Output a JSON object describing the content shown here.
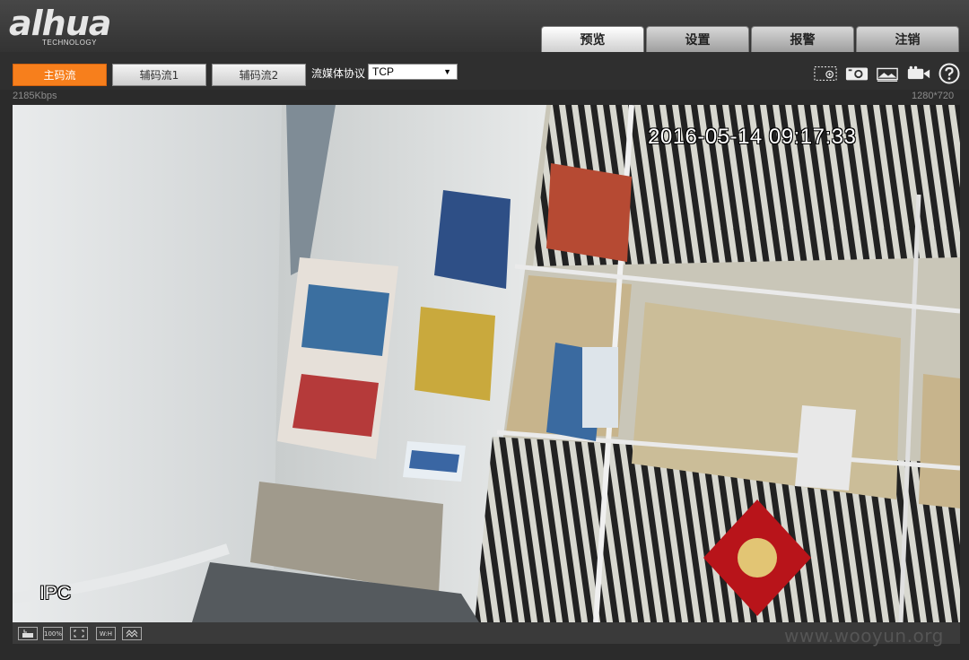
{
  "brand": {
    "name": "alhua",
    "tagline": "TECHNOLOGY"
  },
  "nav": {
    "tabs": [
      {
        "label": "预览",
        "active": true
      },
      {
        "label": "设置"
      },
      {
        "label": "报警"
      },
      {
        "label": "注销"
      }
    ]
  },
  "toolbar": {
    "stream_main": "主码流",
    "stream_sub1": "辅码流1",
    "stream_sub2": "辅码流2",
    "protocol_label": "流媒体协议",
    "protocol_value": "TCP",
    "icons": [
      "zoom-region-icon",
      "snapshot-icon",
      "image-adjust-icon",
      "record-icon",
      "help-icon"
    ]
  },
  "status": {
    "bitrate": "2185Kbps",
    "resolution": "1280*720"
  },
  "video": {
    "timestamp": "2016-05-14 09:17:33",
    "channel_name": "IPC"
  },
  "bottom": {
    "zoom_label": "100%",
    "ratio_label": "W:H"
  },
  "watermark": "www.wooyun.org",
  "colors": {
    "accent": "#f77f1c",
    "background": "#2b2b2b"
  }
}
